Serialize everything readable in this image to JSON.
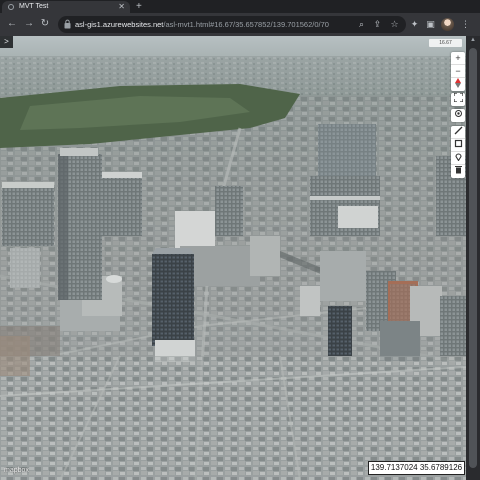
{
  "browser": {
    "tab_title": "MVT Test",
    "tab_close": "✕",
    "new_tab": "+",
    "url_host": "asl-gis1.azurewebsites.net",
    "url_path": "/asl-mvt1.html#16.67/35.657852/139.701562/0/70"
  },
  "map": {
    "collapse_label": ">",
    "zoom_in": "+",
    "zoom_out": "−",
    "zoom_level_label": "16.67",
    "coordinates": "139.7137024 35.6789126",
    "logo": "mapbox",
    "icons": [
      "fullscreen-icon",
      "geolocate-icon",
      "draw-line-icon",
      "draw-polygon-icon",
      "draw-point-icon",
      "trash-icon"
    ]
  },
  "colors": {
    "chrome_dark": "#202124",
    "chrome_toolbar": "#35363a",
    "park_green": "#556b52",
    "sky": "#b9c2c6"
  }
}
